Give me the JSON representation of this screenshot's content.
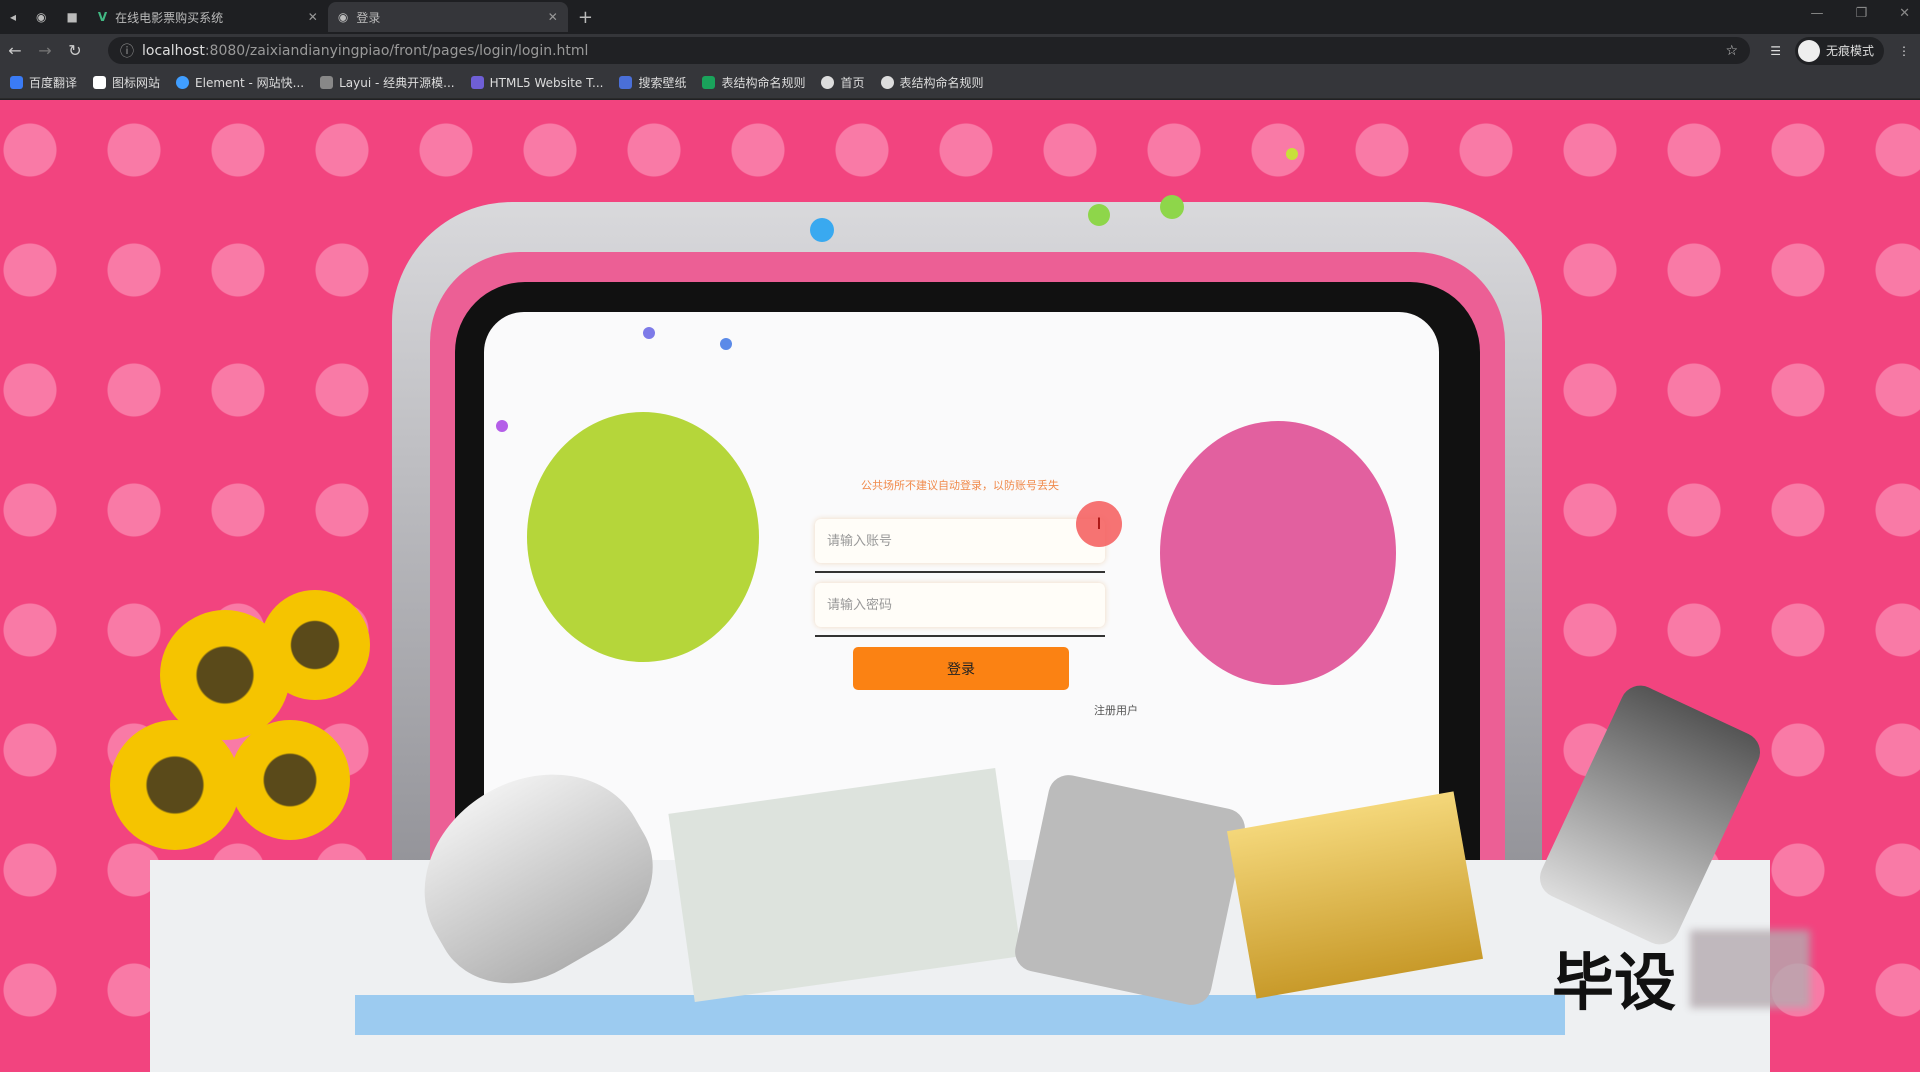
{
  "browser": {
    "tabs": [
      {
        "title": "在线电影票购买系统",
        "icon": "vue-icon"
      },
      {
        "title": "登录",
        "icon": "globe-icon",
        "active": true
      }
    ],
    "url_host": "localhost",
    "url_path": ":8080/zaixiandianyingpiao/front/pages/login/login.html",
    "incognito_label": "无痕模式",
    "bookmarks": [
      {
        "label": "百度翻译",
        "color": "#3a7bf5"
      },
      {
        "label": "图标网站",
        "color": "#ffffff"
      },
      {
        "label": "Element - 网站快...",
        "color": "#409eff"
      },
      {
        "label": "Layui - 经典开源模...",
        "color": "#888888"
      },
      {
        "label": "HTML5 Website T...",
        "color": "#6f5fd6"
      },
      {
        "label": "搜索壁纸",
        "color": "#4a6fd8"
      },
      {
        "label": "表结构命名规则",
        "color": "#1aa35b"
      },
      {
        "label": "首页",
        "color": "#dddddd"
      },
      {
        "label": "表结构命名规则",
        "color": "#dddddd"
      }
    ]
  },
  "login": {
    "notice": "公共场所不建议自动登录，以防账号丢失",
    "account_placeholder": "请输入账号",
    "password_placeholder": "请输入密码",
    "login_button": "登录",
    "register_link": "注册用户"
  },
  "colors": {
    "background": "#f2447f",
    "button": "#fb8213",
    "notice": "#f08a4b",
    "green_bubble": "#b5d63a",
    "pink_bubble": "#e2609f"
  },
  "watermark": "毕设"
}
